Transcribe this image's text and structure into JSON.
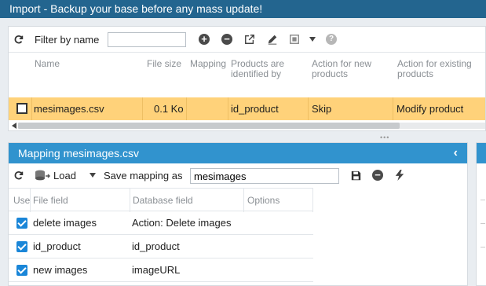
{
  "header": {
    "title": "Import - Backup your base before any mass update!"
  },
  "import_panel": {
    "filter_label": "Filter by name",
    "filter_value": "",
    "columns": [
      "Name",
      "File size",
      "Mapping",
      "Products are identified by",
      "Action for new products",
      "Action for existing products"
    ],
    "rows": [
      {
        "name": "mesimages.csv",
        "file_size": "0.1 Ko",
        "mapping": "",
        "identified_by": "id_product",
        "action_new": "Skip",
        "action_existing": "Modify product"
      }
    ]
  },
  "mapping_panel": {
    "title": "Mapping mesimages.csv",
    "load_label": "Load",
    "save_label": "Save mapping as",
    "mapping_name": "mesimages",
    "columns": [
      "Use",
      "File field",
      "Database field",
      "Options"
    ],
    "rows": [
      {
        "used": true,
        "file_field": "delete images",
        "database_field": "Action: Delete images"
      },
      {
        "used": true,
        "file_field": "id_product",
        "database_field": "id_product"
      },
      {
        "used": true,
        "file_field": "new images",
        "database_field": "imageURL"
      }
    ]
  },
  "colors": {
    "title_bar": "#23658f",
    "panel_header": "#3193ce",
    "selected_row": "#ffd27a",
    "checkbox": "#1a86d8"
  }
}
